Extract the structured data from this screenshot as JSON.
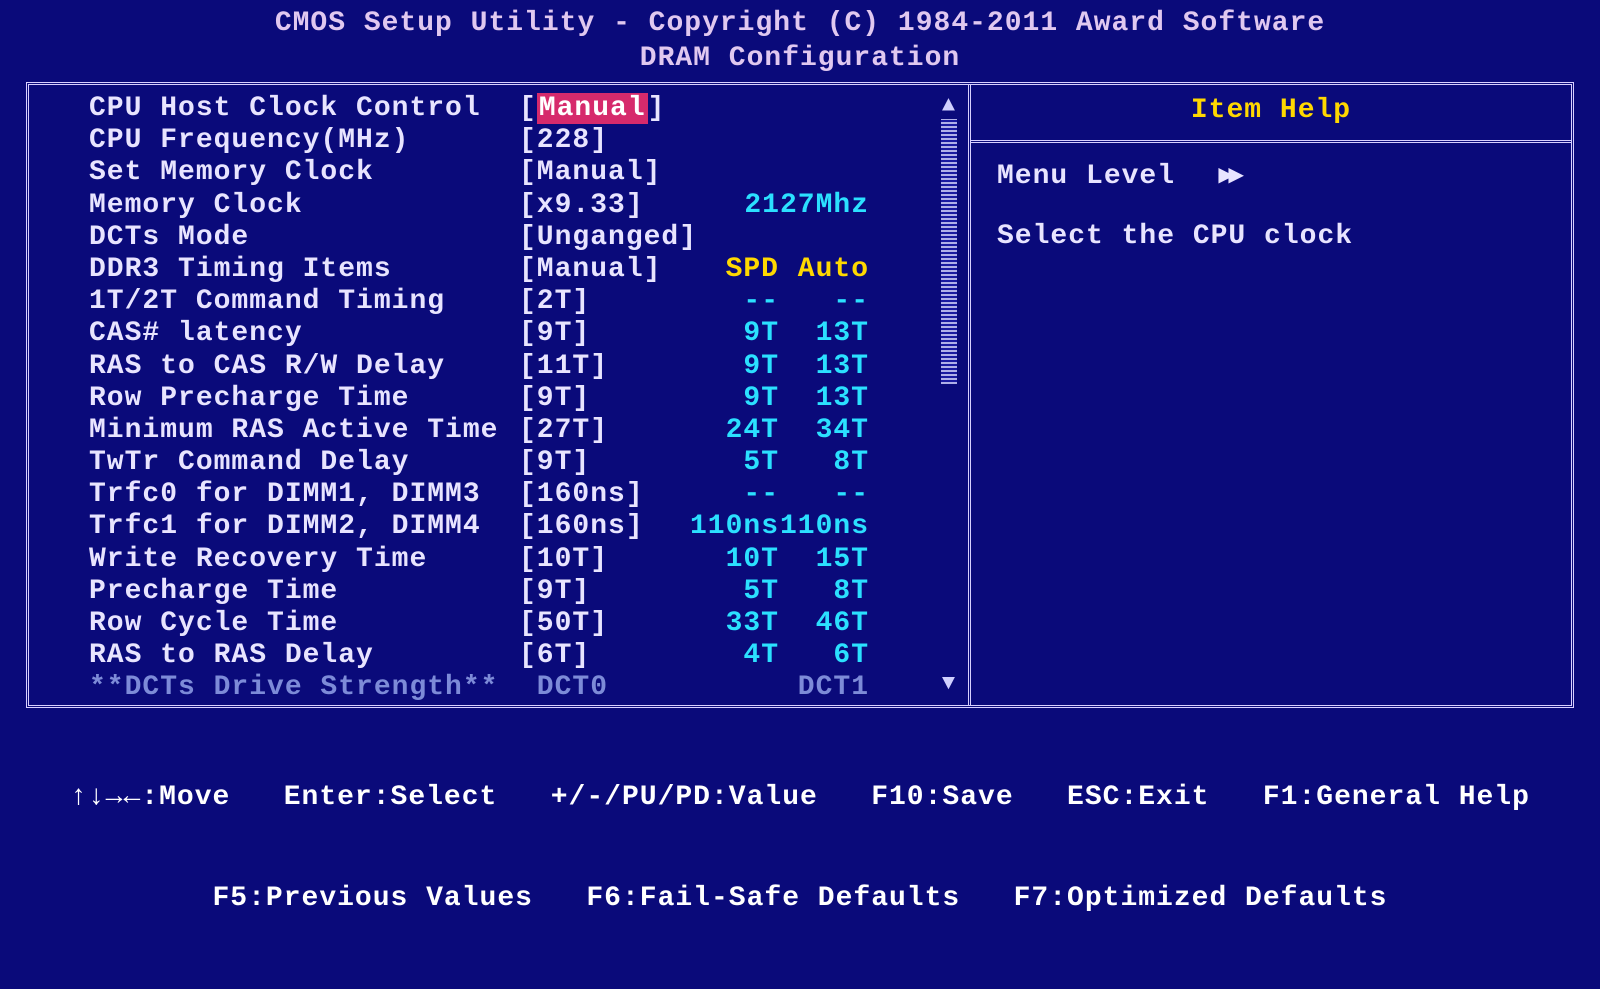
{
  "header": {
    "line1": "CMOS Setup Utility - Copyright (C) 1984-2011 Award Software",
    "line2": "DRAM Configuration"
  },
  "help": {
    "title": "Item Help",
    "menu_level_label": "Menu Level",
    "arrows": "▸▸",
    "text": "Select the CPU clock"
  },
  "columns": {
    "spd": "SPD",
    "auto": "Auto"
  },
  "rows": [
    {
      "label": "CPU Host Clock Control",
      "value": "Manual",
      "selected": true
    },
    {
      "label": "CPU Frequency(MHz)",
      "value": "228"
    },
    {
      "label": "Set Memory Clock",
      "value": "Manual"
    },
    {
      "label": "Memory Clock",
      "value": "x9.33",
      "suffix": "2127Mhz"
    },
    {
      "label": "DCTs Mode",
      "value": "Unganged"
    },
    {
      "label": "DDR3 Timing Items",
      "value": "Manual",
      "header": true
    },
    {
      "label": "1T/2T Command Timing",
      "value": "2T",
      "spd": "--",
      "auto": "--"
    },
    {
      "label": "CAS# latency",
      "value": "9T",
      "spd": "9T",
      "auto": "13T"
    },
    {
      "label": "RAS to CAS R/W Delay",
      "value": "11T",
      "spd": "9T",
      "auto": "13T"
    },
    {
      "label": "Row Precharge Time",
      "value": "9T",
      "spd": "9T",
      "auto": "13T"
    },
    {
      "label": "Minimum RAS Active Time",
      "value": "27T",
      "spd": "24T",
      "auto": "34T"
    },
    {
      "label": "TwTr Command Delay",
      "value": "9T",
      "spd": "5T",
      "auto": "8T"
    },
    {
      "label": "Trfc0 for DIMM1, DIMM3",
      "value": "160ns",
      "spd": "--",
      "auto": "--"
    },
    {
      "label": "Trfc1 for DIMM2, DIMM4",
      "value": "160ns",
      "spd": "110ns",
      "auto": "110ns"
    },
    {
      "label": "Write Recovery Time",
      "value": "10T",
      "spd": "10T",
      "auto": "15T"
    },
    {
      "label": "Precharge Time",
      "value": "9T",
      "spd": "5T",
      "auto": "8T"
    },
    {
      "label": "Row Cycle Time",
      "value": "50T",
      "spd": "33T",
      "auto": "46T"
    },
    {
      "label": "RAS to RAS Delay",
      "value": "6T",
      "spd": "4T",
      "auto": "6T"
    },
    {
      "label": "**DCTs Drive Strength**",
      "plain_left": "DCT0",
      "plain_right": "DCT1",
      "ghost": true
    }
  ],
  "footer": {
    "line1": "↑↓→←:Move   Enter:Select   +/-/PU/PD:Value   F10:Save   ESC:Exit   F1:General Help",
    "line2": "F5:Previous Values   F6:Fail-Safe Defaults   F7:Optimized Defaults"
  }
}
